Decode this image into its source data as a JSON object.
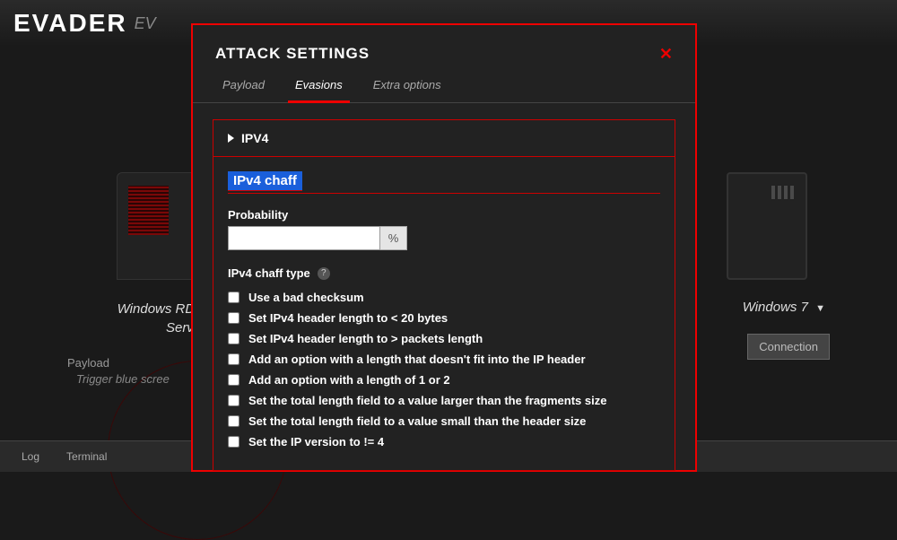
{
  "header": {
    "logo_main": "EVADER",
    "logo_sub": "EV"
  },
  "background": {
    "device_left_text": "Windows RDP .\nService",
    "device_right_text": "Windows 7",
    "connection_button": "Connection",
    "payload_label": "Payload",
    "payload_desc": "Trigger blue scree"
  },
  "footer": {
    "tabs": [
      "Log",
      "Terminal"
    ]
  },
  "modal": {
    "title": "ATTACK SETTINGS",
    "tabs": {
      "payload": "Payload",
      "evasions": "Evasions",
      "extra": "Extra options"
    },
    "ipv4_header": "IPV4",
    "chaff": {
      "title": "IPv4 chaff",
      "probability_label": "Probability",
      "probability_unit": "%",
      "type_label": "IPv4 chaff type",
      "options": [
        "Use a bad checksum",
        "Set IPv4 header length to < 20 bytes",
        "Set IPv4 header length to > packets length",
        "Add an option with a length that doesn't fit into the IP header",
        "Add an option with a length of 1 or 2",
        "Set the total length field to a value larger than the fragments size",
        "Set the total length field to a value small than the header size",
        "Set the IP version to != 4"
      ]
    }
  }
}
